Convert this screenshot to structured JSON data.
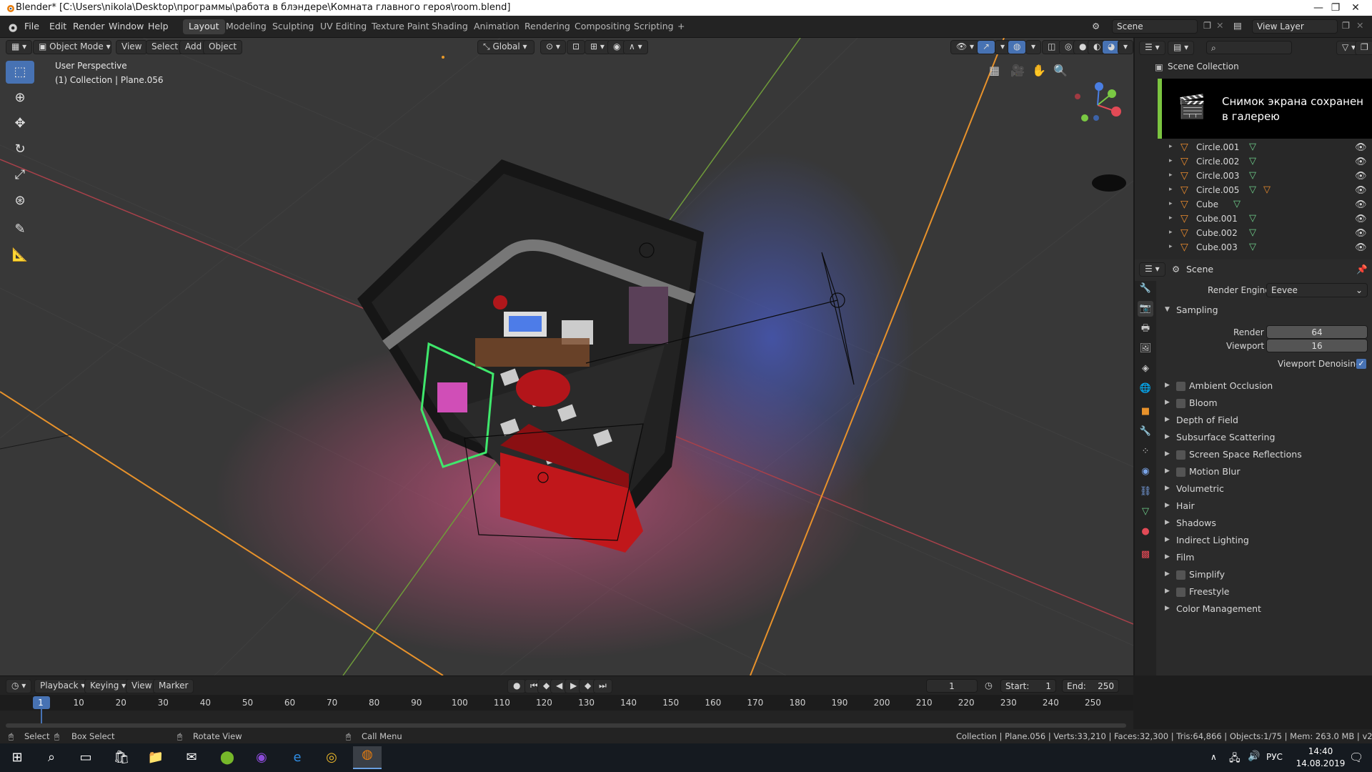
{
  "window": {
    "title": "Blender* [C:\\Users\\nikola\\Desktop\\программы\\работа в блэндере\\Комната главного героя\\room.blend]",
    "minimize": "—",
    "restore": "❐",
    "close": "✕"
  },
  "menu": [
    "File",
    "Edit",
    "Render",
    "Window",
    "Help"
  ],
  "workspaces": [
    "Layout",
    "Modeling",
    "Sculpting",
    "UV Editing",
    "Texture Paint",
    "Shading",
    "Animation",
    "Rendering",
    "Compositing",
    "Scripting",
    "+"
  ],
  "scene_selector": "Scene",
  "viewlayer_selector": "View Layer",
  "viewport_header": {
    "mode": "Object Mode",
    "menus": [
      "View",
      "Select",
      "Add",
      "Object"
    ],
    "orientation": "Global"
  },
  "viewport": {
    "view_name": "User Perspective",
    "collection_info": "(1) Collection | Plane.056"
  },
  "outliner": {
    "root": "Scene Collection",
    "items": [
      {
        "name": "Circle.001",
        "extra": false
      },
      {
        "name": "Circle.002",
        "extra": false
      },
      {
        "name": "Circle.003",
        "extra": false
      },
      {
        "name": "Circle.005",
        "extra": true
      },
      {
        "name": "Cube",
        "extra": false
      },
      {
        "name": "Cube.001",
        "extra": false
      },
      {
        "name": "Cube.002",
        "extra": false
      },
      {
        "name": "Cube.003",
        "extra": false
      }
    ]
  },
  "notification": "Снимок экрана сохранен в галерею",
  "properties": {
    "header": "Scene",
    "render_engine_label": "Render Engine",
    "render_engine": "Eevee",
    "sampling_label": "Sampling",
    "render_label": "Render",
    "render_samples": "64",
    "viewport_label": "Viewport",
    "viewport_samples": "16",
    "denoising_label": "Viewport Denoising",
    "panels": [
      {
        "label": "Ambient Occlusion",
        "checkbox": true
      },
      {
        "label": "Bloom",
        "checkbox": true
      },
      {
        "label": "Depth of Field",
        "checkbox": false
      },
      {
        "label": "Subsurface Scattering",
        "checkbox": false
      },
      {
        "label": "Screen Space Reflections",
        "checkbox": true
      },
      {
        "label": "Motion Blur",
        "checkbox": true
      },
      {
        "label": "Volumetric",
        "checkbox": false
      },
      {
        "label": "Hair",
        "checkbox": false
      },
      {
        "label": "Shadows",
        "checkbox": false
      },
      {
        "label": "Indirect Lighting",
        "checkbox": false
      },
      {
        "label": "Film",
        "checkbox": false
      },
      {
        "label": "Simplify",
        "checkbox": true
      },
      {
        "label": "Freestyle",
        "checkbox": true
      },
      {
        "label": "Color Management",
        "checkbox": false
      }
    ]
  },
  "timeline": {
    "menus": [
      "Playback",
      "Keying",
      "View",
      "Marker"
    ],
    "current_frame": "1",
    "start_label": "Start:",
    "start": "1",
    "end_label": "End:",
    "end": "250",
    "ticks": [
      "1",
      "10",
      "20",
      "30",
      "40",
      "50",
      "60",
      "70",
      "80",
      "90",
      "100",
      "110",
      "120",
      "130",
      "140",
      "150",
      "160",
      "170",
      "180",
      "190",
      "200",
      "210",
      "220",
      "230",
      "240",
      "250"
    ]
  },
  "statusbar": {
    "select": "Select",
    "box_select": "Box Select",
    "rotate_view": "Rotate View",
    "call_menu": "Call Menu",
    "stats": "Collection | Plane.056 | Verts:33,210 | Faces:32,300 | Tris:64,866 | Objects:1/75 | Mem: 263.0 MB | v2.80.74"
  },
  "taskbar": {
    "lang": "РУС",
    "time": "14:40",
    "date": "14.08.2019"
  }
}
